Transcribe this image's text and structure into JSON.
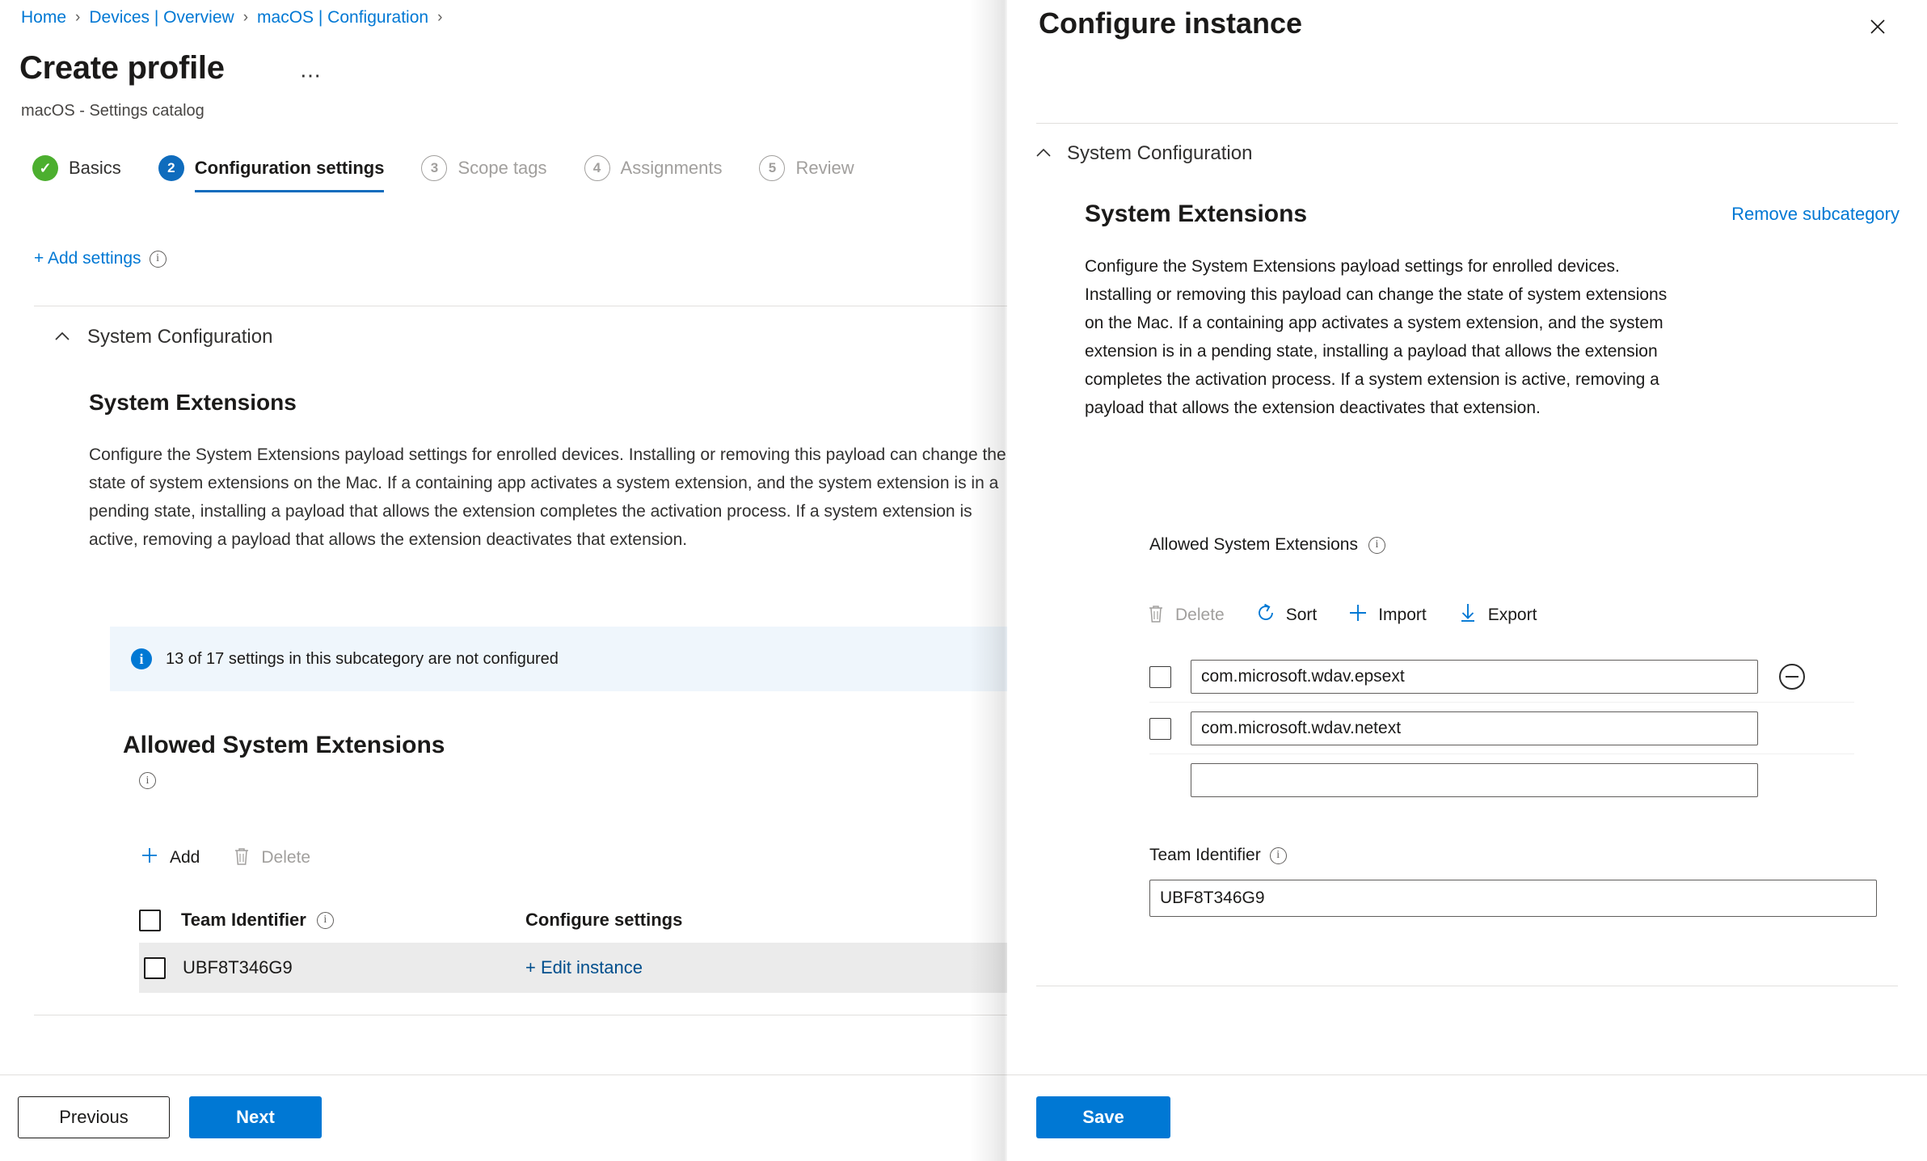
{
  "breadcrumb": {
    "items": [
      "Home",
      "Devices | Overview",
      "macOS | Configuration"
    ],
    "separator": "›"
  },
  "page": {
    "title": "Create profile",
    "ellipsis": "⋯",
    "subtitle": "macOS - Settings catalog"
  },
  "wizard": {
    "steps": [
      {
        "num": "✓",
        "label": "Basics",
        "state": "done"
      },
      {
        "num": "2",
        "label": "Configuration settings",
        "state": "active"
      },
      {
        "num": "3",
        "label": "Scope tags",
        "state": "idle"
      },
      {
        "num": "4",
        "label": "Assignments",
        "state": "idle"
      },
      {
        "num": "5",
        "label": "Review",
        "state": "idle"
      }
    ]
  },
  "main": {
    "add_settings_label": "+ Add settings",
    "add_settings_info": "i",
    "section_title": "System Configuration",
    "block_title": "System Extensions",
    "block_desc": "Configure the System Extensions payload settings for enrolled devices. Installing or removing this payload can change the state of system extensions on the Mac. If a containing app activates a system extension, and the system extension is in a pending state, installing a payload that allows the extension completes the activation process. If a system extension is active, removing a payload that allows the extension deactivates that extension.",
    "info_banner": "13 of 17 settings in this subcategory are not configured",
    "info_icon": "i",
    "sub_title": "Allowed System Extensions",
    "sub_title_info": "i",
    "commands": [
      {
        "label": "Add",
        "icon": "plus-icon",
        "state": "enabled"
      },
      {
        "label": "Delete",
        "icon": "trash-icon",
        "state": "disabled"
      }
    ],
    "table": {
      "headers": [
        "Team Identifier",
        "Configure settings"
      ],
      "header_info": "i",
      "rows": [
        {
          "team_identifier": "UBF8T346G9",
          "action": "+ Edit instance",
          "selected": false
        }
      ]
    }
  },
  "footer": {
    "previous_label": "Previous",
    "next_label": "Next"
  },
  "pane": {
    "title": "Configure instance",
    "close_icon": "✕",
    "section_title": "System Configuration",
    "block_title": "System Extensions",
    "remove_label": "Remove subcategory",
    "block_desc": "Configure the System Extensions payload settings for enrolled devices. Installing or removing this payload can change the state of system extensions on the Mac. If a containing app activates a system extension, and the system extension is in a pending state, installing a payload that allows the extension completes the activation process. If a system extension is active, removing a payload that allows the extension deactivates that extension.",
    "allowed_label": "Allowed System Extensions",
    "allowed_info": "i",
    "commands": [
      {
        "label": "Delete",
        "icon": "trash-icon",
        "state": "disabled"
      },
      {
        "label": "Sort",
        "icon": "sort-refresh-icon",
        "state": "enabled"
      },
      {
        "label": "Import",
        "icon": "plus-icon",
        "state": "enabled"
      },
      {
        "label": "Export",
        "icon": "download-arrow-icon",
        "state": "enabled"
      }
    ],
    "extensions": [
      {
        "value": "com.microsoft.wdav.epsext",
        "placeholder": "",
        "checked": false,
        "has_remove": true
      },
      {
        "value": "com.microsoft.wdav.netext",
        "placeholder": "",
        "checked": false,
        "has_remove": false
      },
      {
        "value": "",
        "placeholder": "",
        "checked": null,
        "has_remove": false
      }
    ],
    "team_identifier": {
      "label": "Team Identifier",
      "info": "i",
      "value": "UBF8T346G9",
      "placeholder": ""
    },
    "save_label": "Save"
  },
  "colors": {
    "accent": "#0078d4",
    "accent_dark": "#004e8c",
    "active_step": "#0f6cbd",
    "done_step": "#4caf2f",
    "info_bg": "#eff6fc",
    "row_bg": "#ebebeb"
  }
}
